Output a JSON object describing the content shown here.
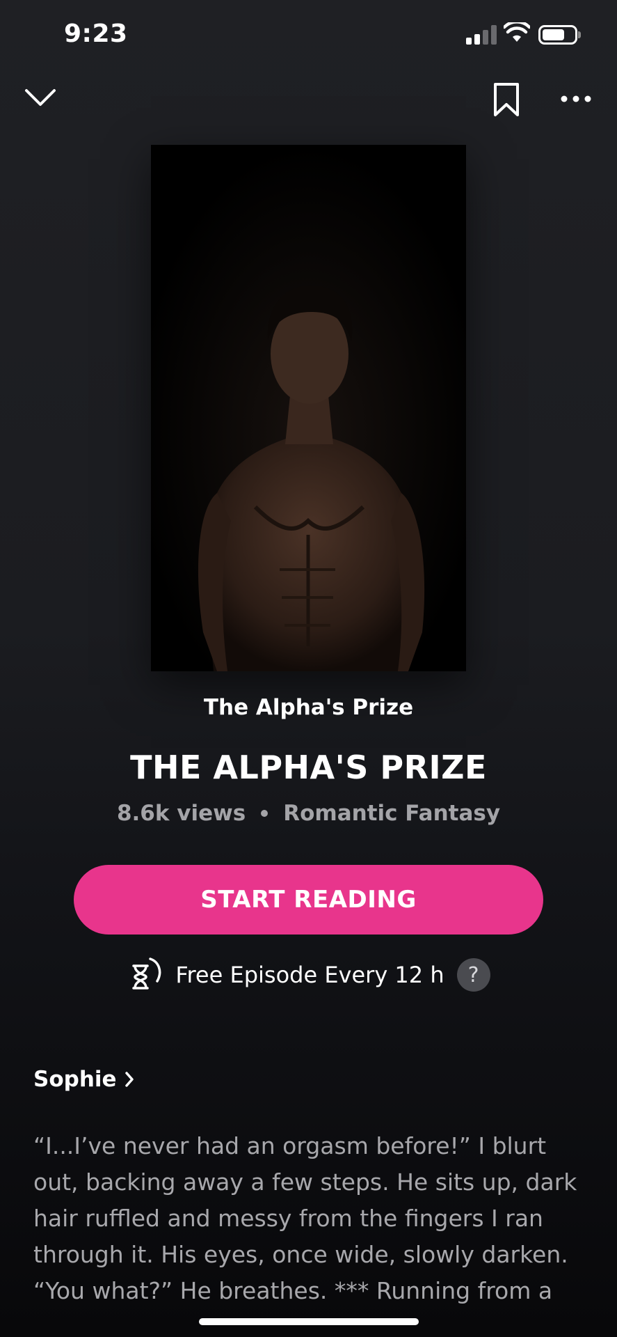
{
  "status_bar": {
    "time": "9:23",
    "signal_icon": "cellular-signal-icon",
    "wifi_icon": "wifi-icon",
    "battery_icon": "battery-icon",
    "battery_level": 0.7
  },
  "nav": {
    "back_icon": "chevron-down-icon",
    "bookmark_icon": "bookmark-icon",
    "more_icon": "more-horizontal-icon"
  },
  "book": {
    "cover_image": "cover-image",
    "subtitle": "The Alpha's Prize",
    "title": "THE ALPHA'S PRIZE",
    "views": "8.6k views",
    "genre": "Romantic Fantasy"
  },
  "actions": {
    "start_label": "START READING",
    "free_episode_text": "Free Episode Every 12 h",
    "help_label": "?",
    "timer_icon": "hourglass-timer-icon"
  },
  "author": {
    "name": "Sophie",
    "chevron": "chevron-right-icon"
  },
  "description": "“I...I’ve never had an orgasm before!” I blurt out, backing away a few steps. He sits up, dark hair ruffled and messy from the fingers I ran through it. His eyes, once wide, slowly darken. “You what?” He breathes. *** Running from a d...",
  "colors": {
    "accent": "#e8358c",
    "background": "#1b1c20",
    "muted_text": "#a4a4a8"
  }
}
